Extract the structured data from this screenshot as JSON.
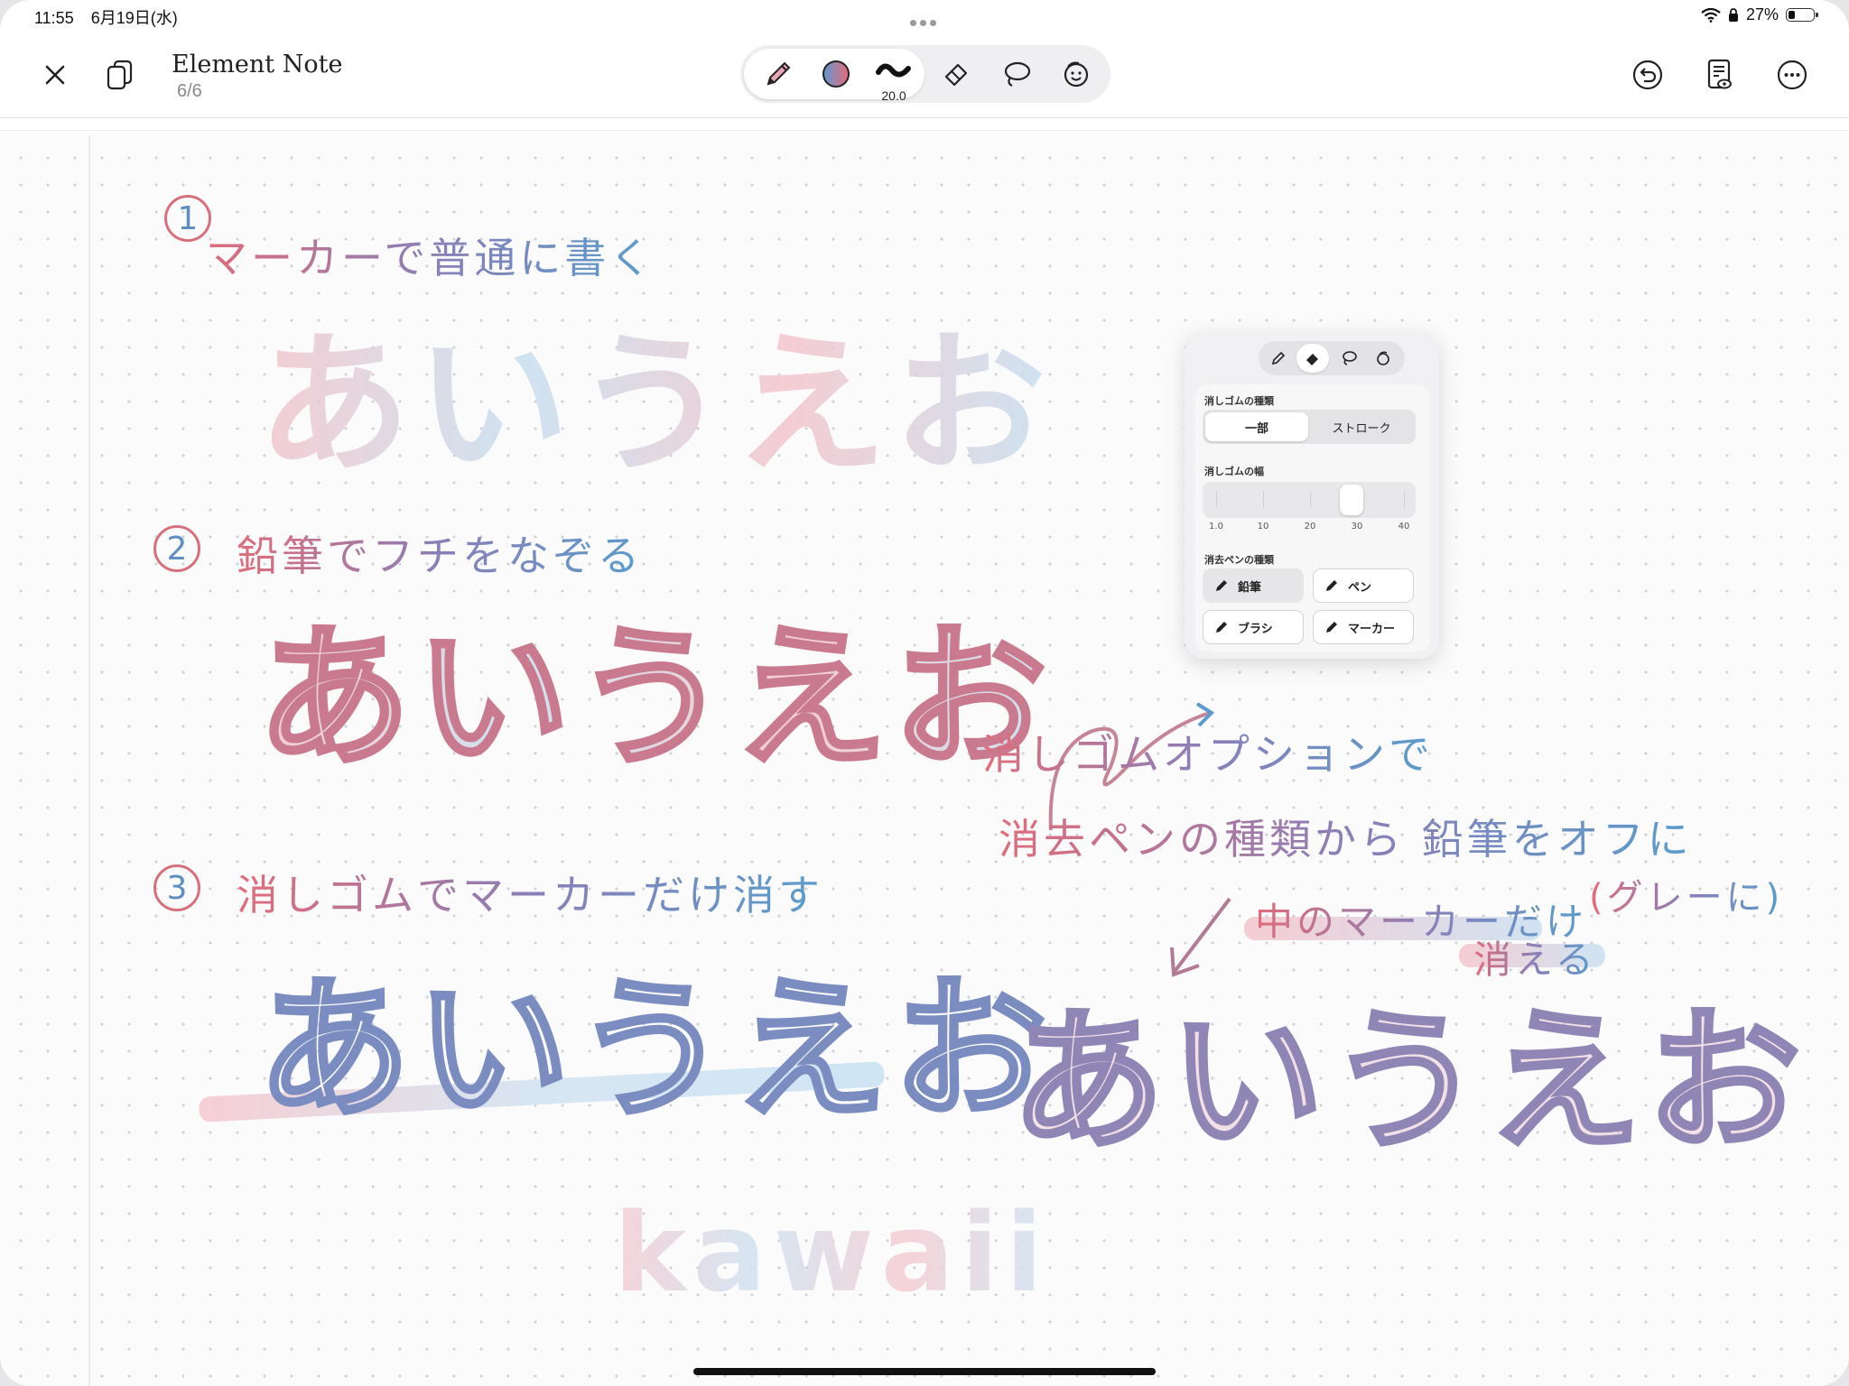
{
  "status_bar": {
    "time": "11:55",
    "date": "6月19日(水)",
    "battery_percent": "27%"
  },
  "header": {
    "title": "Element Note",
    "page_indicator": "6/6",
    "brush_size": "20.0"
  },
  "icons": {
    "close": "close-icon",
    "pages": "pages-icon",
    "pencil": "pencil-icon",
    "color": "color-swatch",
    "stroke": "stroke-width-icon",
    "eraser": "eraser-icon",
    "lasso": "lasso-icon",
    "stickers": "sticker-icon",
    "undo": "undo-icon",
    "reader": "reader-icon",
    "more": "more-icon"
  },
  "colors": {
    "accent_red": "#e06c7a",
    "accent_blue": "#5a9ccc"
  },
  "note": {
    "step1_num": "1",
    "step1_text": "マーカーで普通に書く",
    "step2_num": "2",
    "step2_text": "鉛筆でフチをなぞる",
    "step3_num": "3",
    "step3_text": "消しゴムでマーカーだけ消す",
    "hiragana": "あいうえお",
    "option_line1": "消しゴムオプションで",
    "option_line2": "消去ペンの種類から 鉛筆をオフに",
    "option_gray": "(グレーに)",
    "marker_only_line1": "中のマーカーだけ",
    "marker_only_line2": "消える",
    "kawaii": "kawaii"
  },
  "eraser_popover": {
    "eraser_type_label": "消しゴムの種類",
    "type_options": [
      "一部",
      "ストローク"
    ],
    "selected_type": "一部",
    "width_label": "消しゴムの幅",
    "width_ticks": [
      "1.0",
      "10",
      "20",
      "30",
      "40"
    ],
    "width_value": 30,
    "pen_type_label": "消去ペンの種類",
    "pen_types": [
      {
        "label": "鉛筆",
        "enabled": false
      },
      {
        "label": "ペン",
        "enabled": true
      },
      {
        "label": "ブラシ",
        "enabled": true
      },
      {
        "label": "マーカー",
        "enabled": true
      }
    ]
  }
}
